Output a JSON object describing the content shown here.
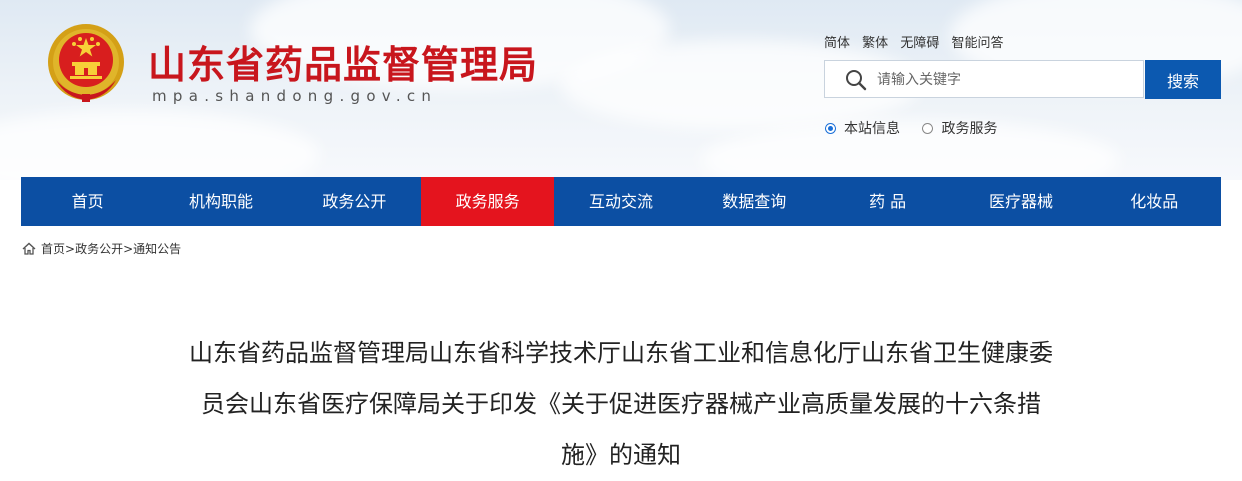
{
  "site": {
    "title": "山东省药品监督管理局",
    "domain": "mpa.shandong.gov.cn",
    "emblem_icon": "national-emblem"
  },
  "top_links": [
    "简体",
    "繁体",
    "无障碍",
    "智能问答"
  ],
  "search": {
    "placeholder": "请输入关键字",
    "value": "",
    "button_label": "搜索",
    "scope_options": [
      {
        "label": "本站信息",
        "selected": true
      },
      {
        "label": "政务服务",
        "selected": false
      }
    ]
  },
  "nav": {
    "items": [
      "首页",
      "机构职能",
      "政务公开",
      "政务服务",
      "互动交流",
      "数据查询",
      "药 品",
      "医疗器械",
      "化妆品"
    ],
    "active_index": 3
  },
  "breadcrumb": {
    "icon": "home-icon",
    "items": [
      "首页",
      "政务公开",
      "通知公告"
    ],
    "separator": ">"
  },
  "article": {
    "title_lines": [
      "山东省药品监督管理局山东省科学技术厅山东省工业和信息化厅山东省卫生健康委",
      "员会山东省医疗保障局关于印发《关于促进医疗器械产业高质量发展的十六条措",
      "施》的通知"
    ]
  },
  "colors": {
    "brand_red": "#c8161d",
    "nav_blue": "#0c4fa3",
    "nav_active_red": "#e4141e",
    "search_button_blue": "#0c59b0"
  }
}
